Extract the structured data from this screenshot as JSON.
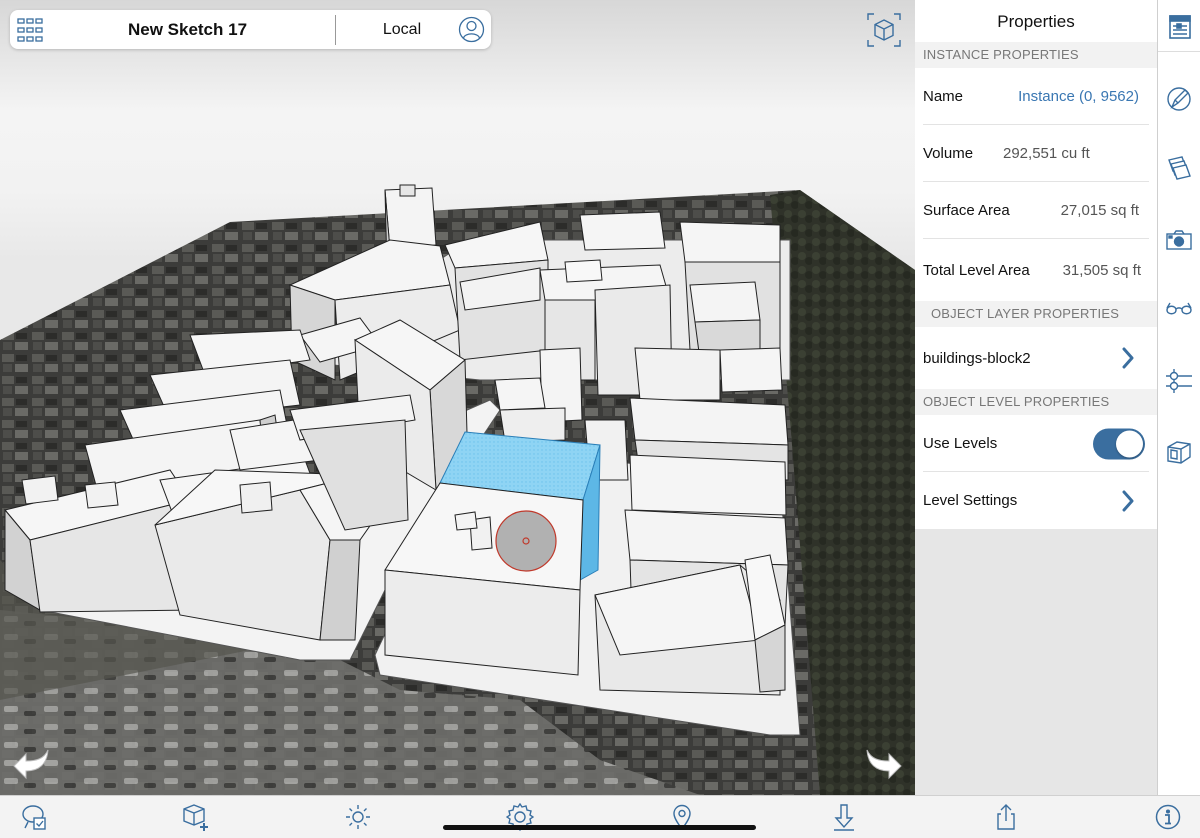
{
  "header": {
    "title": "New Sketch 17",
    "location": "Local"
  },
  "properties_panel": {
    "title": "Properties",
    "instance_section": {
      "header": "INSTANCE PROPERTIES",
      "rows": [
        {
          "label": "Name",
          "value": "Instance (0, 9562)"
        },
        {
          "label": "Volume",
          "value": "292,551 cu ft"
        },
        {
          "label": "Surface Area",
          "value": "27,015 sq ft"
        },
        {
          "label": "Total Level Area",
          "value": "31,505 sq ft"
        }
      ]
    },
    "layer_section": {
      "header": "OBJECT LAYER PROPERTIES",
      "layer_name": "buildings-block2"
    },
    "level_section": {
      "header": "OBJECT LEVEL PROPERTIES",
      "use_levels_label": "Use Levels",
      "use_levels_on": true,
      "level_settings_label": "Level Settings"
    }
  },
  "icons": {
    "header": [
      "grid-icon",
      "user-icon"
    ],
    "viewport": [
      "view-cube-icon",
      "undo-icon",
      "redo-icon"
    ],
    "rail": [
      "properties-icon",
      "pencil-icon",
      "layers-icon",
      "camera-icon",
      "glasses-icon",
      "levels-icon",
      "component-icon"
    ],
    "bottom": [
      "select-icon",
      "add-object-icon",
      "sun-icon",
      "settings-icon",
      "location-pin-icon",
      "download-icon",
      "share-icon",
      "info-icon"
    ]
  },
  "colors": {
    "accent": "#3a77b2",
    "toggle_on": "#3a6e9f",
    "selection": "#8fd4f4",
    "ground": "#3e3e3c"
  }
}
